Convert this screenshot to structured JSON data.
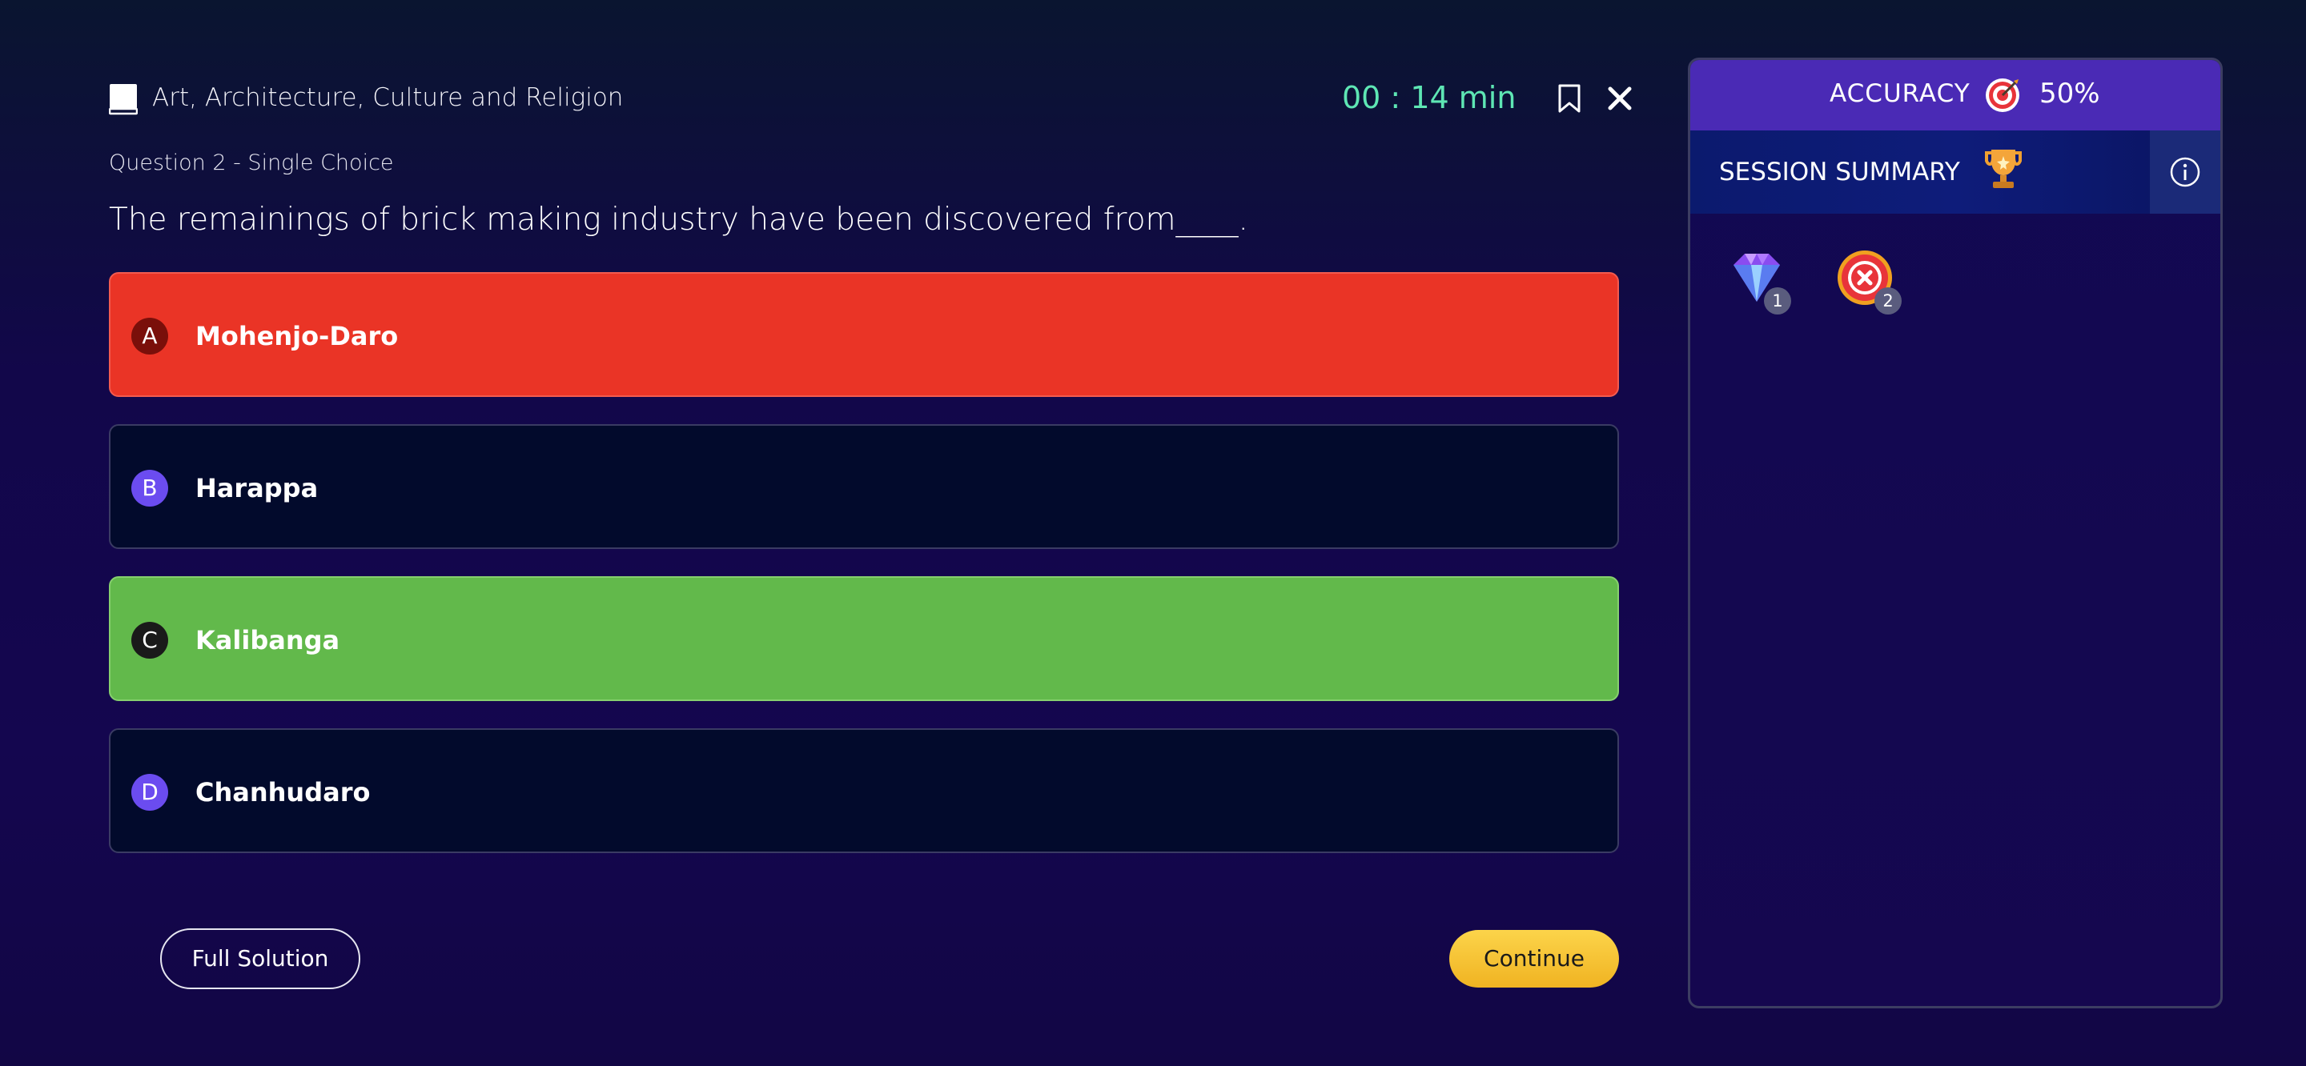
{
  "header": {
    "topic": "Art, Architecture, Culture and Religion",
    "timer": "00 : 14 min"
  },
  "question": {
    "type_label": "Question 2 - Single Choice",
    "text": "The remainings of brick making industry have been discovered from____."
  },
  "options": [
    {
      "letter": "A",
      "label": "Mohenjo-Daro",
      "state": "wrong"
    },
    {
      "letter": "B",
      "label": "Harappa",
      "state": "neutral"
    },
    {
      "letter": "C",
      "label": "Kalibanga",
      "state": "correct"
    },
    {
      "letter": "D",
      "label": "Chanhudaro",
      "state": "neutral"
    }
  ],
  "footer": {
    "full_solution_label": "Full Solution",
    "continue_label": "Continue"
  },
  "panel": {
    "accuracy_label": "ACCURACY",
    "accuracy_value": "50%",
    "summary_label": "SESSION SUMMARY",
    "badges": [
      {
        "icon": "diamond-icon",
        "count": "1"
      },
      {
        "icon": "wrong-answer-icon",
        "count": "2"
      }
    ]
  },
  "colors": {
    "wrong": "#ea3426",
    "correct": "#62b94b",
    "timer": "#5ee6b4",
    "accent": "#6b4cf0",
    "continue": "#f5c232"
  }
}
